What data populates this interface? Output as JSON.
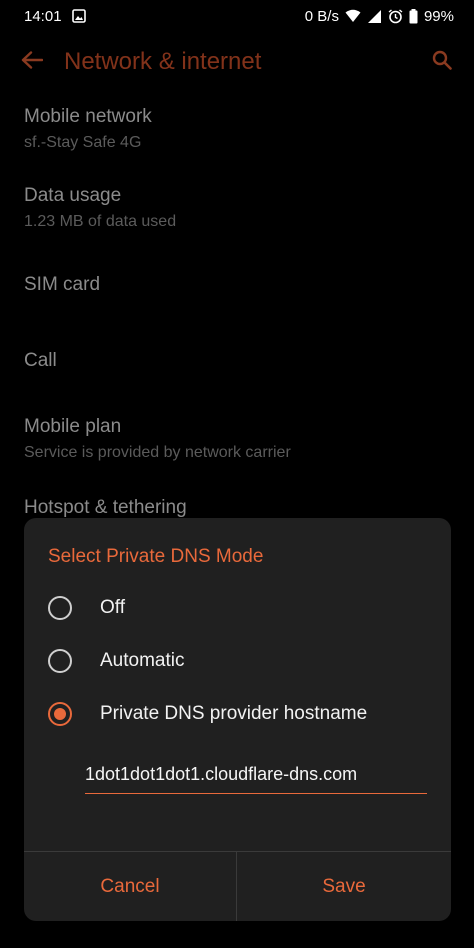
{
  "status_bar": {
    "time": "14:01",
    "net_speed": "0 B/s",
    "battery": "99%",
    "icons": [
      "image-icon",
      "wifi-icon",
      "cell-signal-icon",
      "alarm-icon",
      "battery-icon"
    ]
  },
  "app_bar": {
    "title": "Network & internet"
  },
  "settings": [
    {
      "title": "Mobile network",
      "subtitle": "sf.-Stay Safe 4G"
    },
    {
      "title": "Data usage",
      "subtitle": "1.23 MB of data used"
    },
    {
      "title": "SIM card",
      "subtitle": ""
    },
    {
      "title": "Call",
      "subtitle": ""
    },
    {
      "title": "Mobile plan",
      "subtitle": "Service is provided by network carrier"
    },
    {
      "title": "Hotspot & tethering",
      "subtitle": ""
    }
  ],
  "dialog": {
    "title": "Select Private DNS Mode",
    "options": [
      {
        "label": "Off",
        "selected": false
      },
      {
        "label": "Automatic",
        "selected": false
      },
      {
        "label": "Private DNS provider hostname",
        "selected": true
      }
    ],
    "hostname_value": "1dot1dot1dot1.cloudflare-dns.com",
    "cancel_label": "Cancel",
    "save_label": "Save"
  },
  "colors": {
    "accent": "#e9693b",
    "background": "#000000",
    "dialog": "#202020"
  }
}
